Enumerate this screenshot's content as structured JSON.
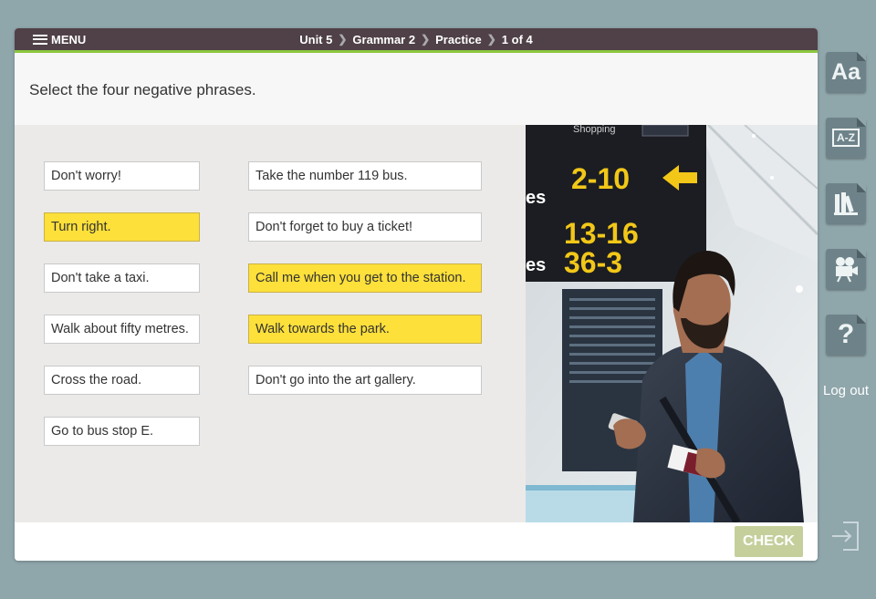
{
  "topbar": {
    "menu_label": "MENU",
    "breadcrumb": [
      "Unit 5",
      "Grammar 2",
      "Practice",
      "1 of 4"
    ]
  },
  "question": {
    "text": "Select the four negative phrases."
  },
  "options": {
    "left": [
      {
        "text": "Don't worry!",
        "selected": false
      },
      {
        "text": "Turn right.",
        "selected": true
      },
      {
        "text": "Don't take a taxi.",
        "selected": false
      },
      {
        "text": "Walk about fifty metres.",
        "selected": false
      },
      {
        "text": "Cross the road.",
        "selected": false
      },
      {
        "text": "Go to bus stop E.",
        "selected": false
      }
    ],
    "right": [
      {
        "text": "Take the number 119 bus.",
        "selected": false
      },
      {
        "text": "Don't forget to buy a ticket!",
        "selected": false
      },
      {
        "text": "Call me when you get to the station.",
        "selected": true
      },
      {
        "text": "Walk towards the park.",
        "selected": true
      },
      {
        "text": "Don't go into the art gallery.",
        "selected": false
      }
    ]
  },
  "photo": {
    "sign_top": "Shopping",
    "sign_line1": "2-10",
    "sign_line2": "13-16",
    "sign_line3": "36-3",
    "sign_partial": "es"
  },
  "footer": {
    "check_label": "CHECK"
  },
  "sidebar": {
    "font_label": "Aa",
    "glossary_label": "A-Z",
    "help_label": "?",
    "logout_label": "Log out"
  },
  "colors": {
    "background": "#8fa6ab",
    "topbar": "#4f4147",
    "accent_green": "#8cc63f",
    "selected_yellow": "#fde03a",
    "check_button": "#c4cf9c",
    "side_button": "#6e8389"
  }
}
